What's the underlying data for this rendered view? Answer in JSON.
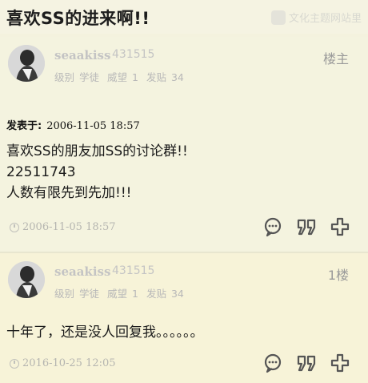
{
  "thread": {
    "title": "喜欢SS的进来啊!!"
  },
  "watermark": {
    "text": "文化主题网站里"
  },
  "posts": [
    {
      "username": "seaakiss",
      "user_id": "431515",
      "stats": {
        "level_label": "级别",
        "level_value": "学徒",
        "prestige_label": "威望",
        "prestige_value": "1",
        "posts_label": "发贴",
        "posts_value": "34"
      },
      "floor": "楼主",
      "posted_label": "发表于:",
      "posted_date": "2006-11-05 18:57",
      "body_lines": [
        "喜欢SS的朋友加SS的讨论群!!",
        "22511743",
        "人数有限先到先加!!!"
      ],
      "footer_time": "2006-11-05 18:57"
    },
    {
      "username": "seaakiss",
      "user_id": "431515",
      "stats": {
        "level_label": "级别",
        "level_value": "学徒",
        "prestige_label": "威望",
        "prestige_value": "1",
        "posts_label": "发贴",
        "posts_value": "34"
      },
      "floor": "1楼",
      "body_lines": [
        "十年了，还是没人回复我。。。。。。"
      ],
      "footer_time": "2016-10-25 12:05"
    }
  ],
  "icons": {
    "reply": "comment-icon",
    "quote": "quote-icon",
    "add": "plus-icon",
    "clock": "clock-icon"
  },
  "colors": {
    "background": "#f4f2de",
    "reply_background": "#f7f3d8",
    "muted_text": "#c4c4c4",
    "icon_color": "#555555"
  }
}
